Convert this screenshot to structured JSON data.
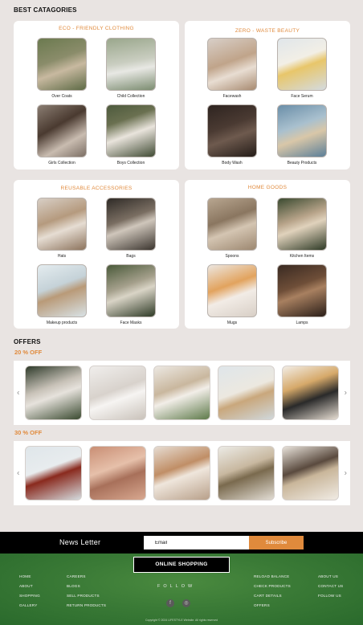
{
  "best_categories": {
    "title": "BEST CATAGORIES",
    "cards": [
      {
        "title": "ECO - FRIENDLY CLOTHING",
        "items": [
          {
            "label": "Over Coats"
          },
          {
            "label": "Child Collection"
          },
          {
            "label": "Girls Collection"
          },
          {
            "label": "Boys Collection"
          }
        ]
      },
      {
        "title": "ZERO - WASTE  BEAUTY",
        "items": [
          {
            "label": "Facewash"
          },
          {
            "label": "Face Serum"
          },
          {
            "label": "Body Wash"
          },
          {
            "label": "Beauty Products"
          }
        ]
      },
      {
        "title": "REUSABLE ACCESSORIES",
        "items": [
          {
            "label": "Hats"
          },
          {
            "label": "Bags"
          },
          {
            "label": "Makeup products"
          },
          {
            "label": "Face Masks"
          }
        ]
      },
      {
        "title": "HOME GOODS",
        "items": [
          {
            "label": "Spoons"
          },
          {
            "label": "Kitchen Items"
          },
          {
            "label": "Mugs"
          },
          {
            "label": "Lamps"
          }
        ]
      }
    ]
  },
  "offers": {
    "title": "OFFERS",
    "groups": [
      {
        "label": "20 % OFF"
      },
      {
        "label": "30 % OFF"
      }
    ],
    "prev_icon": "‹",
    "next_icon": "›"
  },
  "newsletter": {
    "title": "News Letter",
    "placeholder": "Email",
    "button": "Subscribe"
  },
  "footer": {
    "brand_button": "ONLINE SHOPPING",
    "follow_label": "FOLLOW",
    "col1": [
      "HOME",
      "ABOUT",
      "SHOPPING",
      "GALLERY"
    ],
    "col2": [
      "CAREERS",
      "BLOGS",
      "SELL PRODUCTS",
      "RETURN PRODUCTS"
    ],
    "col3": [
      "RELOAD BALANCE",
      "CHECK PRODUCTS",
      "CART DETAILS",
      "OFFERS"
    ],
    "col4": [
      "ABOUT US",
      "CONTACT US",
      "FOLLOW US"
    ],
    "social_icons": [
      "facebook-icon",
      "instagram-icon"
    ],
    "facebook_glyph": "f",
    "instagram_glyph": "◎",
    "copyright": "Copyright © 2024 LIFESTYLE Website. All rights reserved"
  },
  "colors": {
    "accent": "#e08a3c",
    "page_bg": "#e9e4e2",
    "footer_green": "#3a7a36",
    "newsletter_bg": "#000000"
  }
}
